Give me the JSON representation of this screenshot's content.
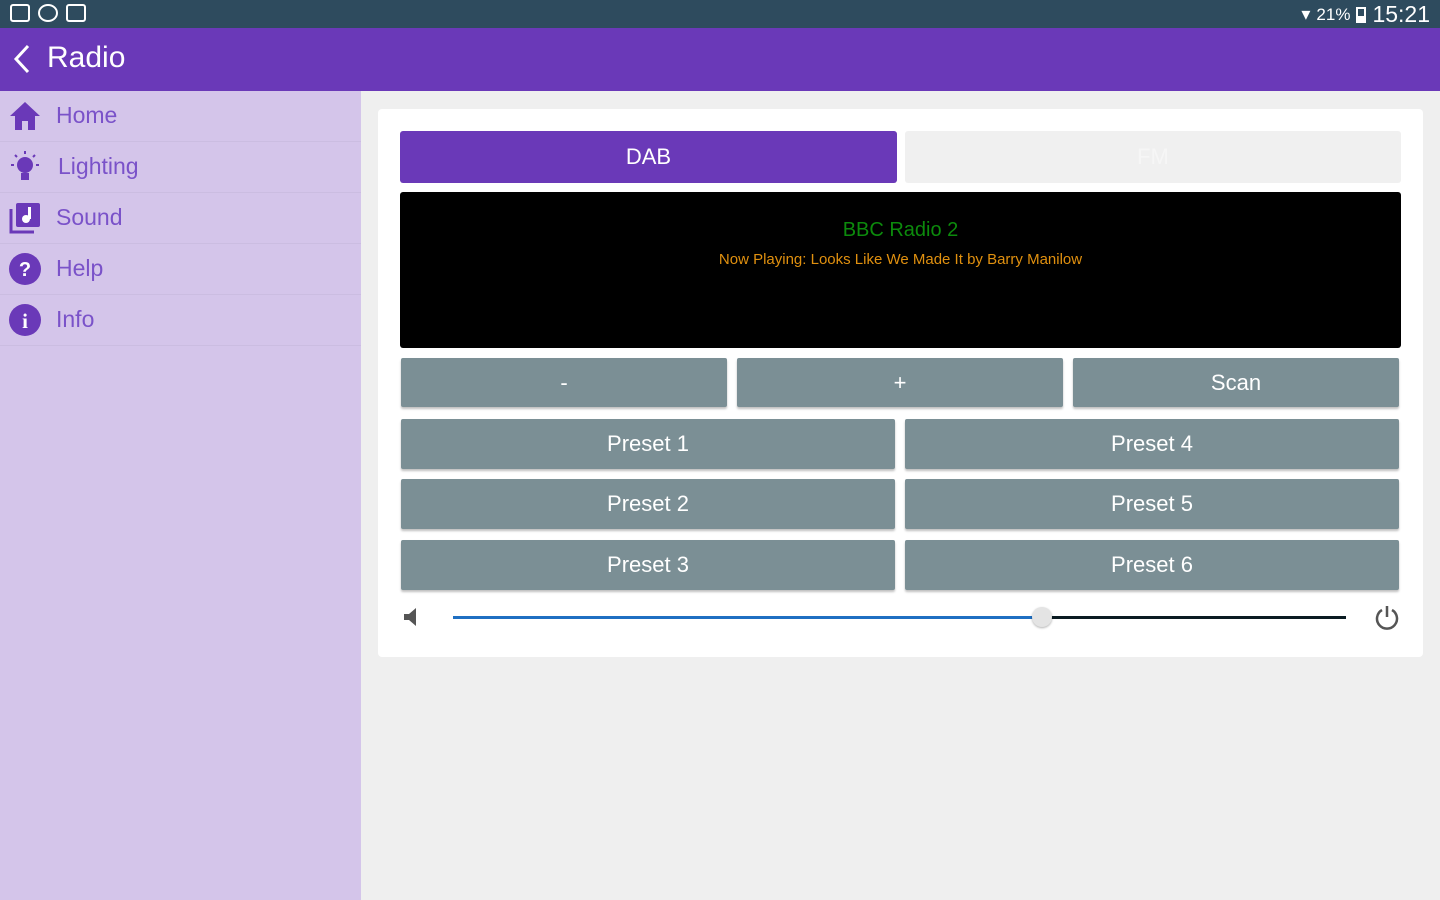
{
  "status_bar": {
    "battery": "21%",
    "time": "15:21"
  },
  "app_bar": {
    "title": "Radio"
  },
  "sidebar": {
    "items": [
      {
        "label": "Home",
        "icon": "home-icon"
      },
      {
        "label": "Lighting",
        "icon": "lightbulb-icon"
      },
      {
        "label": "Sound",
        "icon": "music-library-icon"
      },
      {
        "label": "Help",
        "icon": "help-icon"
      },
      {
        "label": "Info",
        "icon": "info-icon"
      }
    ]
  },
  "radio": {
    "tabs": [
      {
        "label": "DAB",
        "active": true
      },
      {
        "label": "FM",
        "active": false
      }
    ],
    "display": {
      "station": "BBC Radio 2",
      "now_playing": "Now Playing: Looks Like We Made It by Barry Manilow"
    },
    "controls": {
      "minus": "-",
      "plus": "+",
      "scan": "Scan"
    },
    "presets": [
      "Preset 1",
      "Preset 2",
      "Preset 3",
      "Preset 4",
      "Preset 5",
      "Preset 6"
    ],
    "volume_level": 0.66
  },
  "colors": {
    "accent": "#6a39b8",
    "sidebar_bg": "#d4c5ea",
    "station_text": "#0c8a0c",
    "now_playing_text": "#e0900f",
    "button_bg": "#7b8f95",
    "slider_fill": "#1f6fc2"
  }
}
